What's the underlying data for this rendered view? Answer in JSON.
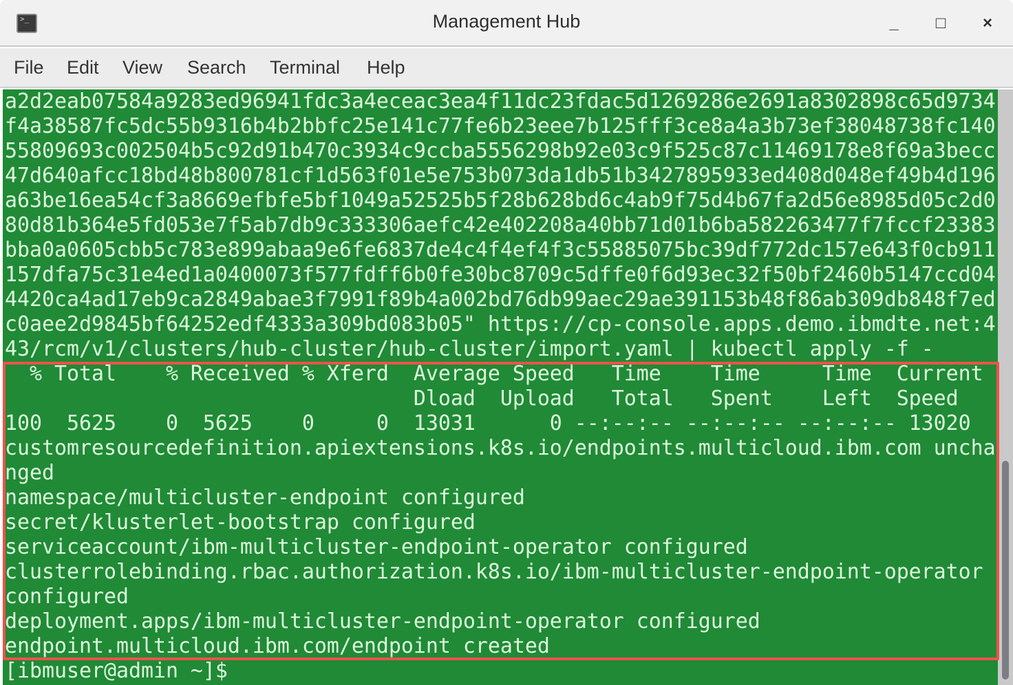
{
  "window": {
    "title": "Management Hub",
    "minimize_label": "_",
    "maximize_label": "□",
    "close_label": "×",
    "app_icon_glyph": ">_"
  },
  "menu": [
    "File",
    "Edit",
    "View",
    "Search",
    "Terminal",
    "Help"
  ],
  "terminal": {
    "lines": [
      "a2d2eab07584a9283ed96941fdc3a4eceac3ea4f11dc23fdac5d1269286e2691a8302898c65d9734",
      "f4a38587fc5dc55b9316b4b2bbfc25e141c77fe6b23eee7b125fff3ce8a4a3b73ef38048738fc140",
      "55809693c002504b5c92d91b470c3934c9ccba5556298b92e03c9f525c87c11469178e8f69a3becc",
      "47d640afcc18bd48b800781cf1d563f01e5e753b073da1db51b3427895933ed408d048ef49b4d196",
      "a63be16ea54cf3a8669efbfe5bf1049a52525b5f28b628bd6c4ab9f75d4b67fa2d56e8985d05c2d0",
      "80d81b364e5fd053e7f5ab7db9c333306aefc42e402208a40bb71d01b6ba582263477f7fccf23383",
      "bba0a0605cbb5c783e899abaa9e6fe6837de4c4f4ef4f3c55885075bc39df772dc157e643f0cb911",
      "157dfa75c31e4ed1a0400073f577fdff6b0fe30bc8709c5dffe0f6d93ec32f50bf2460b5147ccd04",
      "4420ca4ad17eb9ca2849abae3f7991f89b4a002bd76db99aec29ae391153b48f86ab309db848f7ed",
      "c0aee2d9845bf64252edf4333a309bd083b05\" https://cp-console.apps.demo.ibmdte.net:4",
      "43/rcm/v1/clusters/hub-cluster/hub-cluster/import.yaml | kubectl apply -f -",
      "  % Total    % Received % Xferd  Average Speed   Time    Time     Time  Current",
      "                                 Dload  Upload   Total   Spent    Left  Speed",
      "100  5625    0  5625    0     0  13031      0 --:--:-- --:--:-- --:--:-- 13020",
      "customresourcedefinition.apiextensions.k8s.io/endpoints.multicloud.ibm.com uncha",
      "nged",
      "namespace/multicluster-endpoint configured",
      "secret/klusterlet-bootstrap configured",
      "serviceaccount/ibm-multicluster-endpoint-operator configured",
      "clusterrolebinding.rbac.authorization.k8s.io/ibm-multicluster-endpoint-operator",
      "configured",
      "deployment.apps/ibm-multicluster-endpoint-operator configured",
      "endpoint.multicloud.ibm.com/endpoint created",
      "[ibmuser@admin ~]$ "
    ]
  },
  "colors": {
    "terminal_bg": "#208a36",
    "terminal_fg": "#dcf7dc",
    "highlight_border": "#f0524a"
  }
}
